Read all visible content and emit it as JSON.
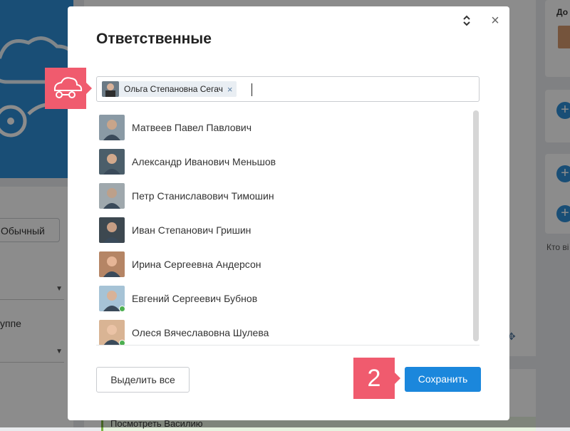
{
  "background": {
    "type_button": "Обычный",
    "group_label": "уппе",
    "right_text": "Кто ві",
    "right_header": "До",
    "bottom_text": "Посмотреть Василию",
    "plus_glyph": "+"
  },
  "modal": {
    "title": "Ответственные",
    "close_glyph": "×",
    "selected": {
      "label": "Ольга Степановна Сегач",
      "remove_glyph": "×"
    },
    "people": [
      {
        "name": "Матвеев Павел Павлович",
        "online": false,
        "skin": "#c9a58a",
        "bg": "#8a9aa5"
      },
      {
        "name": "Александр Иванович Меньшов",
        "online": false,
        "skin": "#d2a98c",
        "bg": "#4b5e6a"
      },
      {
        "name": "Петр Станиславович Тимошин",
        "online": false,
        "skin": "#bda08a",
        "bg": "#9fa8ad"
      },
      {
        "name": "Иван Степанович Гришин",
        "online": false,
        "skin": "#c79e84",
        "bg": "#3d4850"
      },
      {
        "name": "Ирина Сергеевна Андерсон",
        "online": false,
        "skin": "#e6b596",
        "bg": "#b58565"
      },
      {
        "name": "Евгений Сергеевич Бубнов",
        "online": true,
        "skin": "#d8b298",
        "bg": "#a6c3d6"
      },
      {
        "name": "Олеся Вячеславовна Шулева",
        "online": true,
        "skin": "#ebc3a6",
        "bg": "#d9b494"
      }
    ],
    "select_all_label": "Выделить все",
    "save_label": "Сохранить"
  },
  "callouts": {
    "step2": "2"
  },
  "colors": {
    "accent": "#1b87dc",
    "callout": "#f05b6e",
    "online": "#4caf50"
  }
}
